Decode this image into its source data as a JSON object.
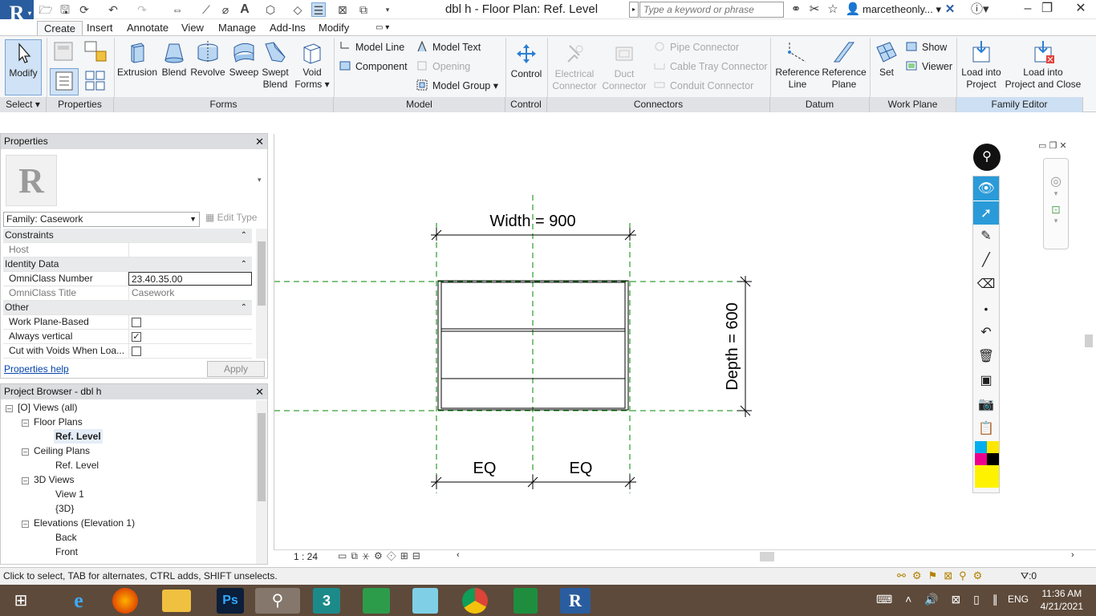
{
  "titlebar": {
    "logo": "R",
    "document_title": "dbl h - Floor Plan: Ref. Level",
    "search_placeholder": "Type a keyword or phrase",
    "user": "marcetheonly..."
  },
  "tabs": [
    {
      "label": "Create",
      "active": true
    },
    {
      "label": "Insert"
    },
    {
      "label": "Annotate"
    },
    {
      "label": "View"
    },
    {
      "label": "Manage"
    },
    {
      "label": "Add-Ins"
    },
    {
      "label": "Modify"
    }
  ],
  "ribbon": {
    "select": {
      "modify": "Modify",
      "panel": "Select"
    },
    "properties": {
      "panel": "Properties"
    },
    "forms": {
      "panel": "Forms",
      "extrusion": "Extrusion",
      "blend": "Blend",
      "revolve": "Revolve",
      "sweep": "Sweep",
      "swept_blend_1": "Swept",
      "swept_blend_2": "Blend",
      "void_1": "Void",
      "void_2": "Forms"
    },
    "model": {
      "panel": "Model",
      "model_line": "Model  Line",
      "component": "Component",
      "model_text": "Model  Text",
      "opening": "Opening",
      "model_group": "Model  Group"
    },
    "control": {
      "panel": "Control",
      "control": "Control"
    },
    "connectors": {
      "panel": "Connectors",
      "electrical_1": "Electrical",
      "electrical_2": "Connector",
      "duct_1": "Duct",
      "duct_2": "Connector",
      "pipe": "Pipe  Connector",
      "cable_tray": "Cable Tray  Connector",
      "conduit": "Conduit  Connector"
    },
    "datum": {
      "panel": "Datum",
      "ref_line_1": "Reference",
      "ref_line_2": "Line",
      "ref_plane_1": "Reference",
      "ref_plane_2": "Plane"
    },
    "work_plane": {
      "panel": "Work Plane",
      "set": "Set",
      "show": "Show",
      "viewer": "Viewer"
    },
    "family_editor": {
      "panel": "Family Editor",
      "load_1": "Load into",
      "load_2": "Project",
      "load_close_1": "Load into",
      "load_close_2": "Project and Close"
    }
  },
  "properties": {
    "title": "Properties",
    "family": "Family: Casework",
    "edit_type": "Edit Type",
    "sections": {
      "constraints": "Constraints",
      "identity": "Identity Data",
      "other": "Other"
    },
    "rows": {
      "host": {
        "label": "Host",
        "value": ""
      },
      "omniclass_number": {
        "label": "OmniClass Number",
        "value": "23.40.35.00"
      },
      "omniclass_title": {
        "label": "OmniClass Title",
        "value": "Casework"
      },
      "work_plane_based": {
        "label": "Work Plane-Based",
        "checked": false
      },
      "always_vertical": {
        "label": "Always vertical",
        "checked": true
      },
      "cut_with_voids": {
        "label": "Cut with Voids When Loa...",
        "checked": false
      }
    },
    "help": "Properties help",
    "apply": "Apply"
  },
  "browser": {
    "title": "Project Browser - dbl h",
    "items": [
      {
        "label": "Views (all)",
        "level": 0
      },
      {
        "label": "Floor Plans",
        "level": 1
      },
      {
        "label": "Ref. Level",
        "level": 2,
        "selected": true
      },
      {
        "label": "Ceiling Plans",
        "level": 1
      },
      {
        "label": "Ref. Level",
        "level": 2
      },
      {
        "label": "3D Views",
        "level": 1
      },
      {
        "label": "View 1",
        "level": 2
      },
      {
        "label": "{3D}",
        "level": 2
      },
      {
        "label": "Elevations (Elevation 1)",
        "level": 1
      },
      {
        "label": "Back",
        "level": 2
      },
      {
        "label": "Front",
        "level": 2
      }
    ]
  },
  "drawing": {
    "width_dim": "Width = 900",
    "depth_dim": "Depth = 600",
    "eq_left": "EQ",
    "eq_right": "EQ"
  },
  "view_bar": {
    "scale": "1 : 24"
  },
  "status": {
    "text": "Click to select, TAB for alternates, CTRL adds, SHIFT unselects.",
    "filter_count": ":0"
  },
  "taskbar": {
    "lang": "ENG",
    "time": "11:36 AM",
    "date": "4/21/2021"
  },
  "colors": {
    "accent": "#2a5d9f",
    "grid_line": "#008a00",
    "ribbon_bg": "#f5f6f7"
  }
}
